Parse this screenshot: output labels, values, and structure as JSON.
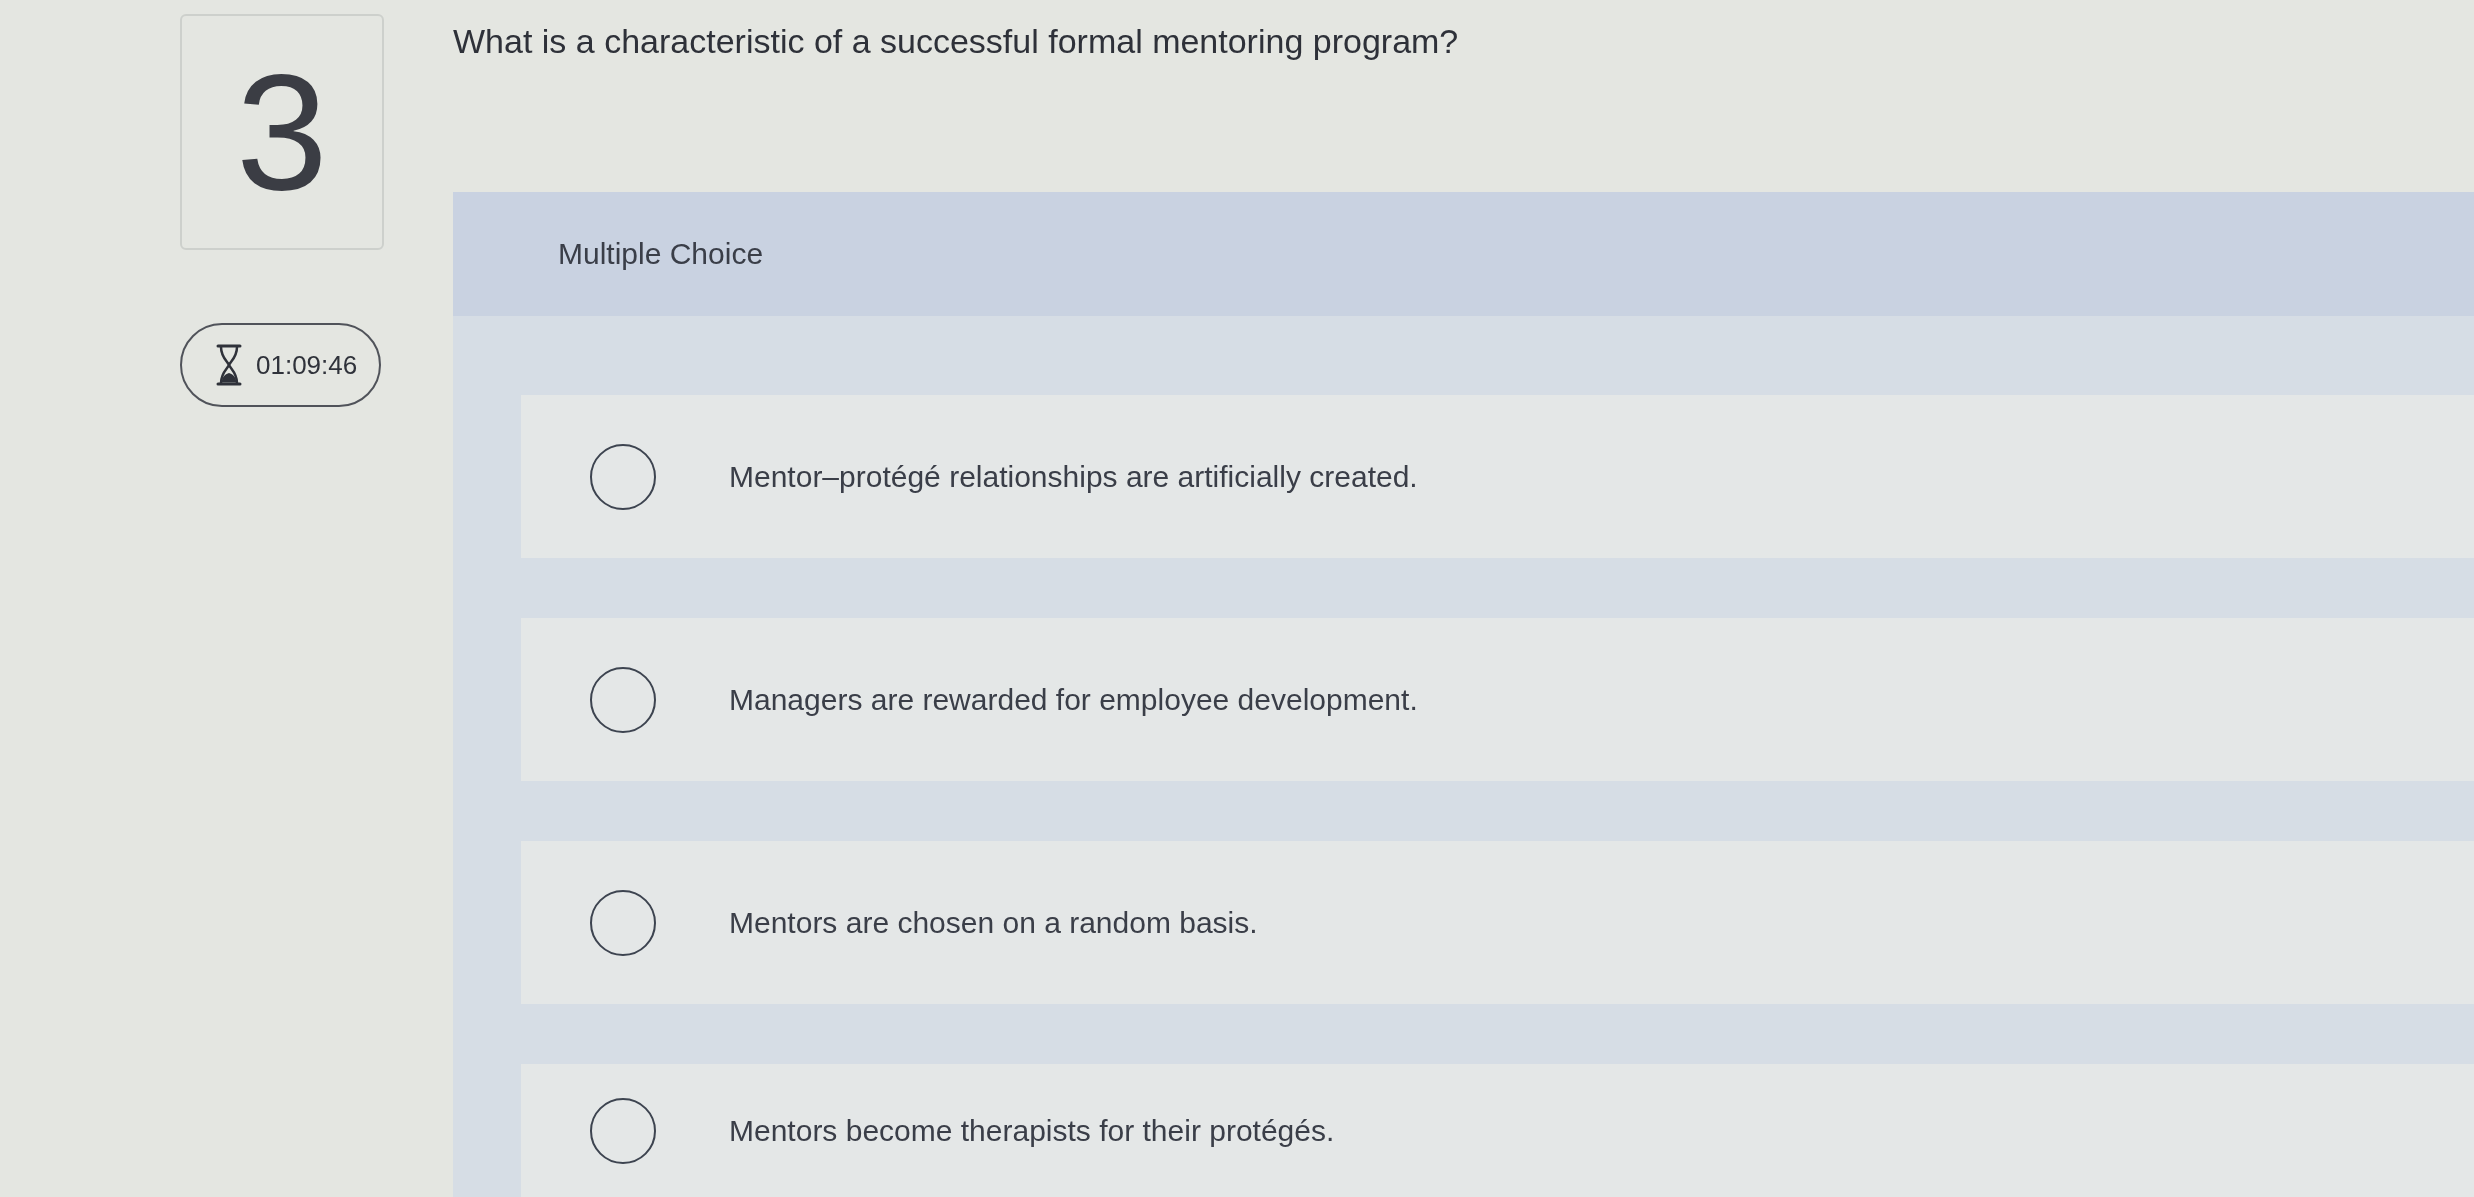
{
  "question": {
    "number": "3",
    "timer": "01:09:46",
    "text": "What is a characteristic of a successful formal mentoring program?",
    "type_label": "Multiple Choice"
  },
  "options": [
    {
      "text": "Mentor–protégé relationships are artificially created.",
      "selected": false
    },
    {
      "text": "Managers are rewarded for employee development.",
      "selected": false
    },
    {
      "text": "Mentors are chosen on a random basis.",
      "selected": false
    },
    {
      "text": "Mentors become therapists for their protégés.",
      "selected": false
    }
  ]
}
